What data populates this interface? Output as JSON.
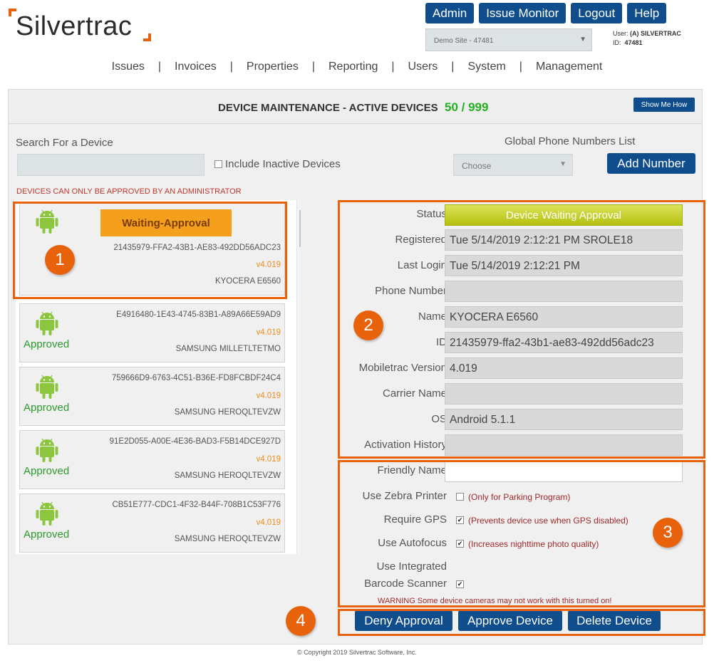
{
  "logo": {
    "text": "Silvertrac"
  },
  "top_buttons": [
    "Admin",
    "Issue Monitor",
    "Logout",
    "Help"
  ],
  "site_select": {
    "value": "Demo Site - 47481"
  },
  "user": {
    "label": "User:",
    "name": "(A) SILVERTRAC",
    "id_label": "ID:",
    "id": "47481"
  },
  "nav": [
    "Issues",
    "Invoices",
    "Properties",
    "Reporting",
    "Users",
    "System",
    "Management"
  ],
  "nav_separator": "|",
  "panel": {
    "title": "DEVICE MAINTENANCE - ACTIVE DEVICES",
    "count": "50 / 999",
    "show_me_how": "Show Me How"
  },
  "search": {
    "label": "Search For a Device",
    "placeholder": "",
    "include_inactive": "Include Inactive Devices"
  },
  "global_phone": {
    "label": "Global Phone Numbers List",
    "select_value": "Choose",
    "add_button": "Add Number"
  },
  "admin_warning": "DEVICES CAN ONLY BE APPROVED BY AN ADMINISTRATOR",
  "devices": [
    {
      "status": "Waiting-Approval",
      "id": "21435979-FFA2-43B1-AE83-492DD56ADC23",
      "version": "v4.019",
      "model": "KYOCERA E6560"
    },
    {
      "status": "Approved",
      "id": "E4916480-1E43-4745-83B1-A89A66E59AD9",
      "version": "v4.019",
      "model": "SAMSUNG MILLETLTETMO"
    },
    {
      "status": "Approved",
      "id": "759666D9-6763-4C51-B36E-FD8FCBDF24C4",
      "version": "v4.019",
      "model": "SAMSUNG HEROQLTEVZW"
    },
    {
      "status": "Approved",
      "id": "91E2D055-A00E-4E36-BAD3-F5B14DCE927D",
      "version": "v4.019",
      "model": "SAMSUNG HEROQLTEVZW"
    },
    {
      "status": "Approved",
      "id": "CB51E777-CDC1-4F32-B44F-708B1C53F776",
      "version": "v4.019",
      "model": "SAMSUNG HEROQLTEVZW"
    }
  ],
  "details": {
    "status_label": "Status",
    "status_value": "Device Waiting Approval",
    "registered_label": "Registered",
    "registered_value": "Tue 5/14/2019 2:12:21 PM SROLE18",
    "last_login_label": "Last Login",
    "last_login_value": "Tue 5/14/2019 2:12:21 PM",
    "phone_label": "Phone Number",
    "phone_value": "",
    "name_label": "Name",
    "name_value": "KYOCERA E6560",
    "id_label": "ID",
    "id_value": "21435979-ffa2-43b1-ae83-492dd56adc23",
    "version_label": "Mobiletrac Version",
    "version_value": "4.019",
    "carrier_label": "Carrier Name",
    "carrier_value": "",
    "os_label": "OS",
    "os_value": "Android 5.1.1",
    "activation_label": "Activation History",
    "activation_value": ""
  },
  "settings": {
    "friendly_label": "Friendly Name",
    "friendly_value": "",
    "zebra_label": "Use Zebra Printer",
    "zebra_note": "(Only for Parking Program)",
    "gps_label": "Require GPS",
    "gps_note": "(Prevents device use when GPS disabled)",
    "autofocus_label": "Use Autofocus",
    "autofocus_note": "(Increases nighttime photo quality)",
    "barcode_label_1": "Use Integrated",
    "barcode_label_2": "Barcode Scanner",
    "barcode_warning": "WARNING Some device cameras may not work with this turned on!"
  },
  "actions": [
    "Deny Approval",
    "Approve Device",
    "Delete Device"
  ],
  "callouts": [
    "1",
    "2",
    "3",
    "4"
  ],
  "copyright": "© Copyright 2019 Silvertrac Software, Inc.",
  "colors": {
    "brand_blue": "#0f4d8c",
    "accent_orange": "#e8620c",
    "approved_green": "#2c9a2c",
    "waiting_orange": "#f4a01d"
  }
}
